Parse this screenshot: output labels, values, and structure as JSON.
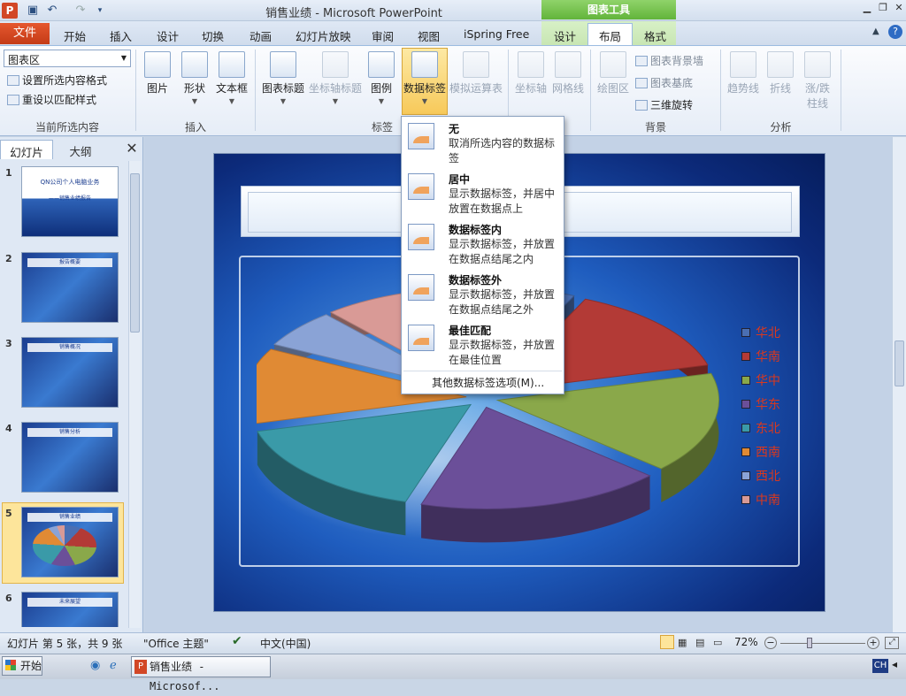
{
  "window": {
    "title": "销售业绩 - Microsoft PowerPoint",
    "context_group": "图表工具"
  },
  "qat": {
    "save_icon": "save-icon",
    "undo_icon": "undo-icon",
    "redo_icon": "redo-icon"
  },
  "tabs": {
    "file": "文件",
    "items": [
      "开始",
      "插入",
      "设计",
      "切换",
      "动画",
      "幻灯片放映",
      "审阅",
      "视图",
      "iSpring Free"
    ],
    "context": [
      "设计",
      "布局",
      "格式"
    ]
  },
  "ribbon": {
    "selector_value": "图表区",
    "format_selection": "设置所选内容格式",
    "reset_style": "重设以匹配样式",
    "group_current": "当前所选内容",
    "insert_picture": "图片",
    "insert_shape": "形状",
    "insert_textbox": "文本框",
    "group_insert": "插入",
    "chart_title": "图表标题",
    "axis_titles": "坐标轴标题",
    "legend": "图例",
    "data_labels": "数据标签",
    "data_table": "模拟运算表",
    "group_labels": "标签",
    "axes": "坐标轴",
    "gridlines": "网格线",
    "plot_area": "绘图区",
    "chart_wall": "图表背景墙",
    "chart_floor": "图表基底",
    "rotation_3d": "三维旋转",
    "group_background": "背景",
    "trendline": "趋势线",
    "lines": "折线",
    "updown": "涨/跌\n柱线",
    "group_analysis": "分析"
  },
  "panel": {
    "tab_slides": "幻灯片",
    "tab_outline": "大纲",
    "thumbs": [
      {
        "num": "1",
        "title": "QN公司个人电脑业务",
        "sub": "——销售业绩报告"
      },
      {
        "num": "2",
        "title": "报告概要"
      },
      {
        "num": "3",
        "title": "销售概况"
      },
      {
        "num": "4",
        "title": "销售分析"
      },
      {
        "num": "5",
        "title": "销售业绩"
      },
      {
        "num": "6",
        "title": "未来展望"
      }
    ]
  },
  "slide": {
    "title_fragment": "售"
  },
  "chart_data": {
    "type": "pie",
    "legend": [
      "华北",
      "华南",
      "华中",
      "华东",
      "东北",
      "西南",
      "西北",
      "中南"
    ],
    "colors": [
      "#4a6fb3",
      "#b33a36",
      "#8aa84a",
      "#6b4f99",
      "#3a9aa8",
      "#e08a34",
      "#8aa3d6",
      "#d99a96"
    ]
  },
  "menu": {
    "items": [
      {
        "title": "无",
        "desc": "取消所选内容的数据标签"
      },
      {
        "title": "居中",
        "desc": "显示数据标签，并居中放置在数据点上"
      },
      {
        "title": "数据标签内",
        "desc": "显示数据标签，并放置在数据点结尾之内"
      },
      {
        "title": "数据标签外",
        "desc": "显示数据标签，并放置在数据点结尾之外"
      },
      {
        "title": "最佳匹配",
        "desc": "显示数据标签，并放置在最佳位置"
      }
    ],
    "more": "其他数据标签选项(M)..."
  },
  "status": {
    "slide_info": "幻灯片 第 5 张，共 9 张",
    "theme": "\"Office 主题\"",
    "language": "中文(中国)",
    "zoom": "72%"
  },
  "taskbar": {
    "start": "开始",
    "app": "销售业绩 - Microsof...",
    "ime": "CH"
  }
}
